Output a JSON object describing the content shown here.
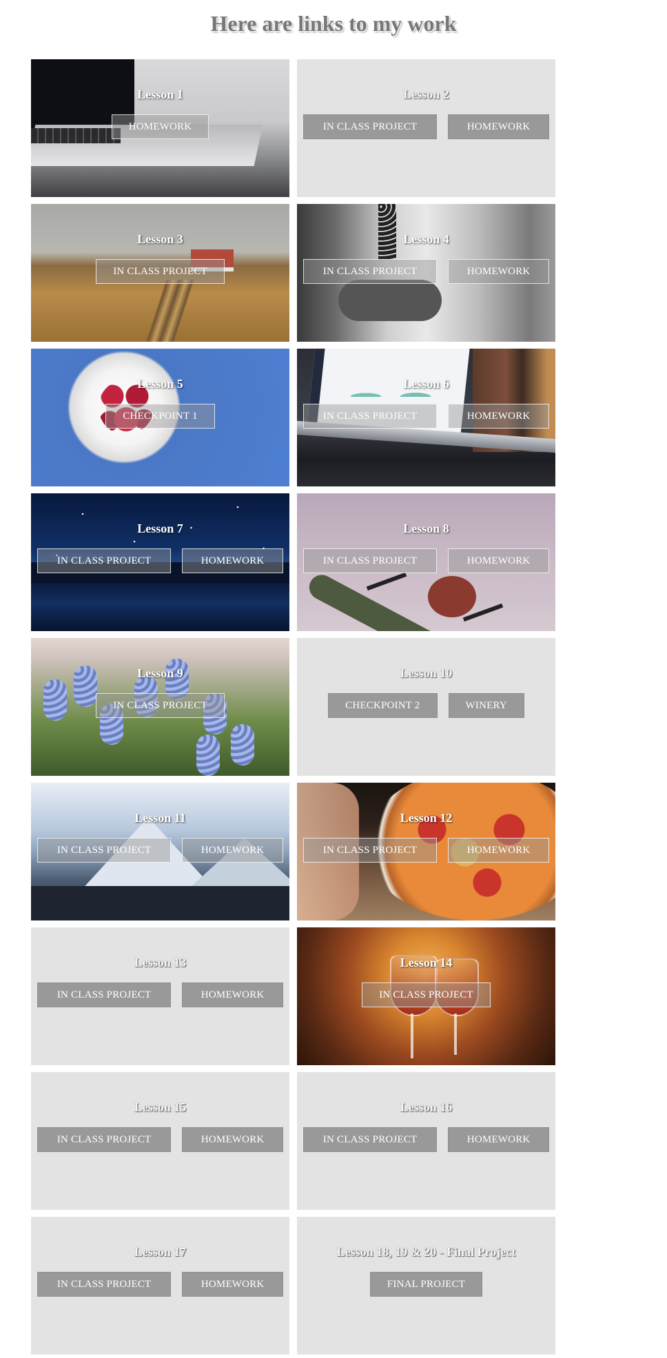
{
  "page": {
    "title": "Here are links to my work"
  },
  "cards": [
    {
      "title": "Lesson 1",
      "buttons": [
        "HOMEWORK"
      ]
    },
    {
      "title": "Lesson 2",
      "buttons": [
        "IN CLASS PROJECT",
        "HOMEWORK"
      ]
    },
    {
      "title": "Lesson 3",
      "buttons": [
        "IN CLASS PROJECT"
      ]
    },
    {
      "title": "Lesson 4",
      "buttons": [
        "IN CLASS PROJECT",
        "HOMEWORK"
      ]
    },
    {
      "title": "Lesson 5",
      "buttons": [
        "CHECKPOINT 1"
      ]
    },
    {
      "title": "Lesson 6",
      "buttons": [
        "IN CLASS PROJECT",
        "HOMEWORK"
      ]
    },
    {
      "title": "Lesson 7",
      "buttons": [
        "IN CLASS PROJECT",
        "HOMEWORK"
      ]
    },
    {
      "title": "Lesson 8",
      "buttons": [
        "IN CLASS PROJECT",
        "HOMEWORK"
      ]
    },
    {
      "title": "Lesson 9",
      "buttons": [
        "IN CLASS PROJECT"
      ]
    },
    {
      "title": "Lesson 10",
      "buttons": [
        "CHECKPOINT 2",
        "WINERY"
      ]
    },
    {
      "title": "Lesson 11",
      "buttons": [
        "IN CLASS PROJECT",
        "HOMEWORK"
      ]
    },
    {
      "title": "Lesson 12",
      "buttons": [
        "IN CLASS PROJECT",
        "HOMEWORK"
      ]
    },
    {
      "title": "Lesson 13",
      "buttons": [
        "IN CLASS PROJECT",
        "HOMEWORK"
      ]
    },
    {
      "title": "Lesson 14",
      "buttons": [
        "IN CLASS PROJECT"
      ]
    },
    {
      "title": "Lesson 15",
      "buttons": [
        "IN CLASS PROJECT",
        "HOMEWORK"
      ]
    },
    {
      "title": "Lesson 16",
      "buttons": [
        "IN CLASS PROJECT",
        "HOMEWORK"
      ]
    },
    {
      "title": "Lesson 17",
      "buttons": [
        "IN CLASS PROJECT",
        "HOMEWORK"
      ]
    },
    {
      "title": "Lesson 18, 19 & 20 - Final Project",
      "buttons": [
        "FINAL PROJECT"
      ]
    }
  ]
}
